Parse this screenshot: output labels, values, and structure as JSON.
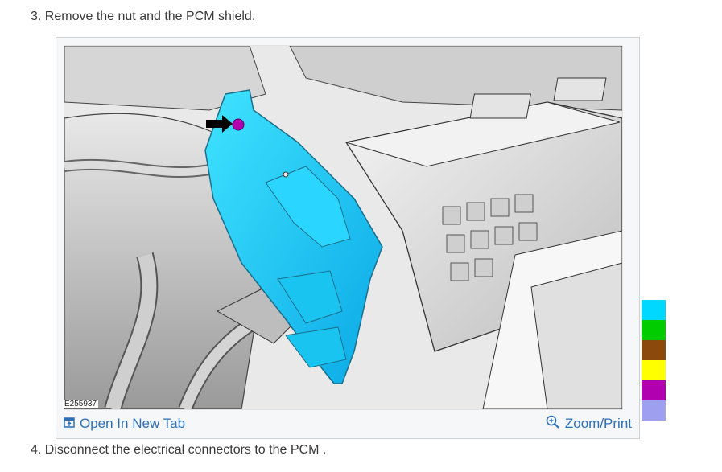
{
  "steps": {
    "step3": "3. Remove the nut and the PCM shield.",
    "step4": "4. Disconnect the electrical connectors to the PCM ."
  },
  "figure": {
    "figure_id": "E255937",
    "open_new_tab_label": "Open In New Tab",
    "zoom_print_label": "Zoom/Print",
    "icons": {
      "open_tab": "open-in-new-tab-icon",
      "zoom": "zoom-in-icon"
    }
  },
  "legend_swatches": [
    "#00d8ff",
    "#00cc00",
    "#8b4a0b",
    "#ffff00",
    "#b000b0",
    "#9f9fef"
  ]
}
